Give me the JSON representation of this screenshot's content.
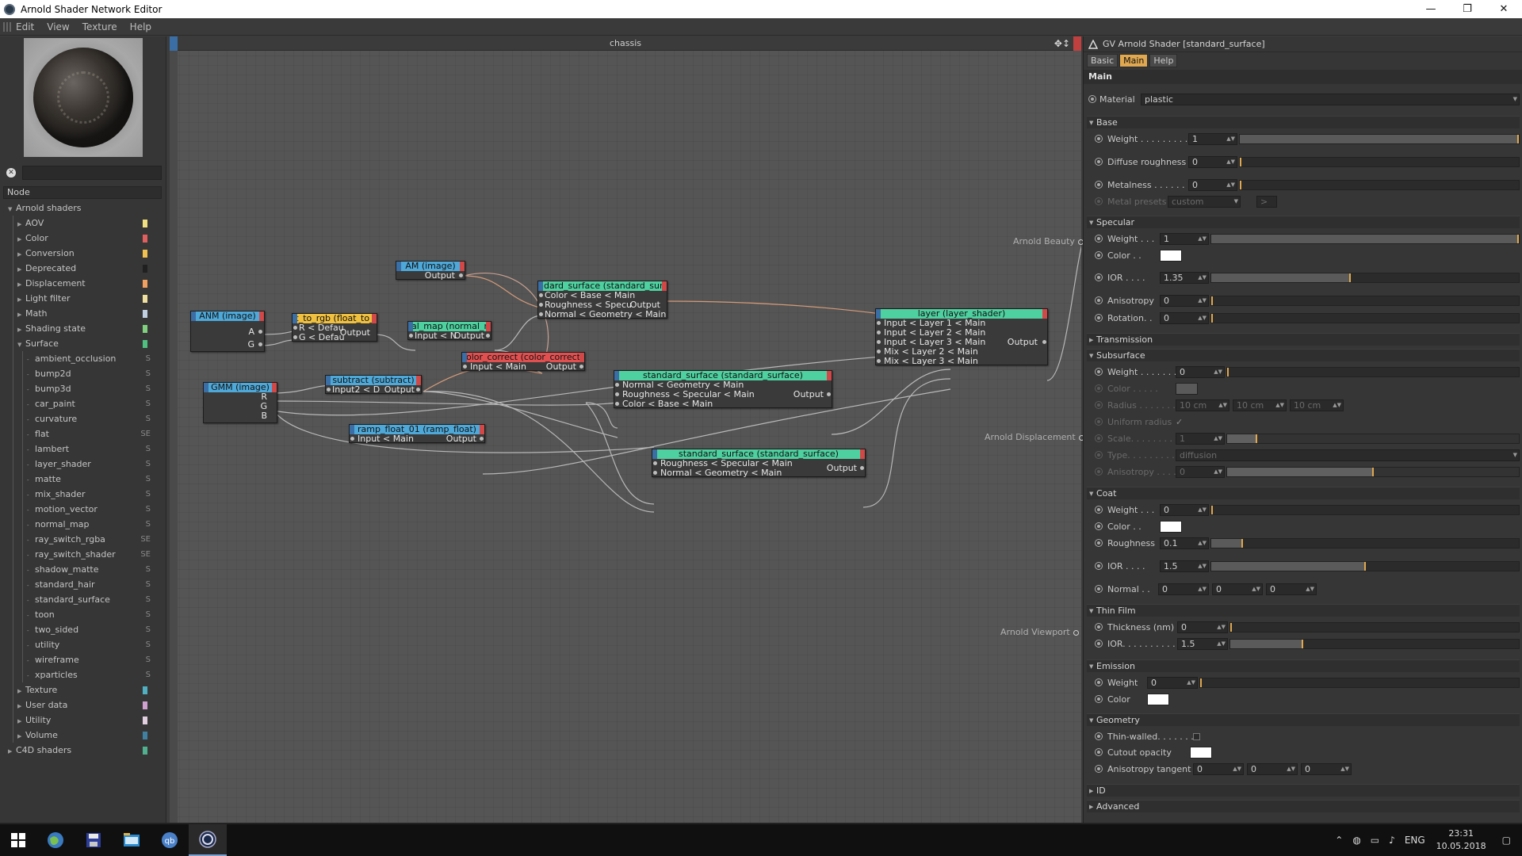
{
  "window": {
    "title": "Arnold Shader Network Editor",
    "buttons": [
      "—",
      "❐",
      "✕"
    ]
  },
  "menu": [
    "Edit",
    "View",
    "Texture",
    "Help"
  ],
  "left": {
    "node_header": "Node",
    "tree": [
      {
        "label": "Arnold shaders",
        "level": 0,
        "arrow": "▼"
      },
      {
        "label": "AOV",
        "level": 1,
        "arrow": "▶",
        "color": "#f0e080"
      },
      {
        "label": "Color",
        "level": 1,
        "arrow": "▶",
        "color": "#e06060"
      },
      {
        "label": "Conversion",
        "level": 1,
        "arrow": "▶",
        "color": "#f0c050"
      },
      {
        "label": "Deprecated",
        "level": 1,
        "arrow": "▶",
        "color": "#202020"
      },
      {
        "label": "Displacement",
        "level": 1,
        "arrow": "▶",
        "color": "#f0a060"
      },
      {
        "label": "Light filter",
        "level": 1,
        "arrow": "▶",
        "color": "#f0e0a0"
      },
      {
        "label": "Math",
        "level": 1,
        "arrow": "▶",
        "color": "#c0d0e0"
      },
      {
        "label": "Shading state",
        "level": 1,
        "arrow": "▶",
        "color": "#80d080"
      },
      {
        "label": "Surface",
        "level": 1,
        "arrow": "▼",
        "color": "#50c080"
      },
      {
        "label": "ambient_occlusion",
        "level": 2,
        "flag": "S"
      },
      {
        "label": "bump2d",
        "level": 2,
        "flag": "S"
      },
      {
        "label": "bump3d",
        "level": 2,
        "flag": "S"
      },
      {
        "label": "car_paint",
        "level": 2,
        "flag": "S"
      },
      {
        "label": "curvature",
        "level": 2,
        "flag": "S"
      },
      {
        "label": "flat",
        "level": 2,
        "flag": "SE"
      },
      {
        "label": "lambert",
        "level": 2,
        "flag": "S"
      },
      {
        "label": "layer_shader",
        "level": 2,
        "flag": "S"
      },
      {
        "label": "matte",
        "level": 2,
        "flag": "S"
      },
      {
        "label": "mix_shader",
        "level": 2,
        "flag": "S"
      },
      {
        "label": "motion_vector",
        "level": 2,
        "flag": "S"
      },
      {
        "label": "normal_map",
        "level": 2,
        "flag": "S"
      },
      {
        "label": "ray_switch_rgba",
        "level": 2,
        "flag": "SE"
      },
      {
        "label": "ray_switch_shader",
        "level": 2,
        "flag": "SE"
      },
      {
        "label": "shadow_matte",
        "level": 2,
        "flag": "S"
      },
      {
        "label": "standard_hair",
        "level": 2,
        "flag": "S"
      },
      {
        "label": "standard_surface",
        "level": 2,
        "flag": "S"
      },
      {
        "label": "toon",
        "level": 2,
        "flag": "S"
      },
      {
        "label": "two_sided",
        "level": 2,
        "flag": "S"
      },
      {
        "label": "utility",
        "level": 2,
        "flag": "S"
      },
      {
        "label": "wireframe",
        "level": 2,
        "flag": "S"
      },
      {
        "label": "xparticles",
        "level": 2,
        "flag": "S"
      },
      {
        "label": "Texture",
        "level": 1,
        "arrow": "▶",
        "color": "#50b0c0"
      },
      {
        "label": "User data",
        "level": 1,
        "arrow": "▶",
        "color": "#d0a0d0"
      },
      {
        "label": "Utility",
        "level": 1,
        "arrow": "▶",
        "color": "#e0d0e0"
      },
      {
        "label": "Volume",
        "level": 1,
        "arrow": "▶",
        "color": "#4080a0"
      },
      {
        "label": "C4D shaders",
        "level": 0,
        "arrow": "▶",
        "color": "#50b090"
      }
    ]
  },
  "canvas": {
    "title": "chassis",
    "nav_icon": "✥↕",
    "outputs": [
      "Arnold Beauty",
      "Arnold Displacement",
      "Arnold Viewport"
    ],
    "nodes": {
      "am": {
        "title": "AM (image)",
        "out": "Output",
        "color": "#4ea8d8"
      },
      "anm": {
        "title": "ANM (image)",
        "a": "A",
        "g": "G",
        "color": "#4ea8d8"
      },
      "ftr": {
        "title": "t_to_rgb (float_to_",
        "r": "R < Defau",
        "g": "G < Defau",
        "out": "Output",
        "color": "#f0c040"
      },
      "nmap": {
        "title": "al_map (normal_r",
        "in": "Input < N",
        "out": "Output",
        "color": "#4ed0a0"
      },
      "ss1": {
        "title": "ndard_surface (standard_surfa",
        "p1": "Color < Base < Main",
        "p2": "Roughness < Specu",
        "p3": "Normal < Geometry < Main",
        "out": "Output",
        "color": "#4ed0a0"
      },
      "cc": {
        "title": "olor_correct (color_correct",
        "in": "Input < Main",
        "out": "Output",
        "color": "#e05050"
      },
      "gmm": {
        "title": "GMM (image)",
        "r": "R",
        "g": "G",
        "b": "B",
        "color": "#4ea8d8"
      },
      "sub": {
        "title": "subtract (subtract)",
        "in": "Input2 < D",
        "out": "Output",
        "color": "#4ea8d8"
      },
      "ss2": {
        "title": "standard_surface (standard_surface)",
        "p1": "Normal < Geometry < Main",
        "p2": "Roughness < Specular < Main",
        "p3": "Color < Base < Main",
        "out": "Output",
        "color": "#4ed0a0"
      },
      "ramp": {
        "title": "ramp_float_01 (ramp_float)",
        "in": "Input < Main",
        "out": "Output",
        "color": "#4ea8d8"
      },
      "ss3": {
        "title": "standard_surface (standard_surface)",
        "p1": "Roughness < Specular < Main",
        "p2": "Normal < Geometry < Main",
        "out": "Output",
        "color": "#4ed0a0"
      },
      "layer": {
        "title": "layer (layer_shader)",
        "p1": "Input < Layer 1 < Main",
        "p2": "Input < Layer 2 < Main",
        "p3": "Input < Layer 3 < Main",
        "p4": "Mix < Layer 2 < Main",
        "p5": "Mix < Layer 3 < Main",
        "out": "Output",
        "color": "#4ed0a0"
      }
    }
  },
  "right": {
    "title": "GV Arnold Shader [standard_surface]",
    "tabs": [
      "Basic",
      "Main",
      "Help"
    ],
    "main_header": "Main",
    "material": {
      "label": "Material",
      "value": "plastic"
    },
    "sections": {
      "base": "Base",
      "specular": "Specular",
      "transmission": "Transmission",
      "subsurface": "Subsurface",
      "coat": "Coat",
      "thin_film": "Thin Film",
      "emission": "Emission",
      "geometry": "Geometry",
      "id": "ID",
      "advanced": "Advanced"
    },
    "base": {
      "weight": {
        "label": "Weight . . . . . . . . .",
        "value": "1",
        "level": 1.0
      },
      "diffuse_roughness": {
        "label": "Diffuse roughness",
        "value": "0",
        "level": 0.0
      },
      "metalness": {
        "label": "Metalness . . . . . .",
        "value": "0",
        "level": 0.0
      },
      "metal_presets": {
        "label": "Metal presets",
        "value": "custom",
        "btn": ">"
      }
    },
    "specular": {
      "weight": {
        "label": "Weight . . .",
        "value": "1",
        "level": 1.0
      },
      "color": {
        "label": "Color . .",
        "value": "#ffffff"
      },
      "ior": {
        "label": "IOR . . . .",
        "value": "1.35",
        "level": 0.45
      },
      "anisotropy": {
        "label": "Anisotropy",
        "value": "0",
        "level": 0.0
      },
      "rotation": {
        "label": "Rotation. .",
        "value": "0",
        "level": 0.0
      }
    },
    "subsurface": {
      "weight": {
        "label": "Weight . . . . . . . .",
        "value": "0",
        "level": 0.0
      },
      "color": {
        "label": "Color . . . . .",
        "value": "#5a5a5a"
      },
      "radius": {
        "label": "Radius . . . . . . . . .",
        "v1": "10 cm",
        "v2": "10 cm",
        "v3": "10 cm"
      },
      "uniform_radius": {
        "label": "Uniform radius",
        "value": "✓"
      },
      "scale": {
        "label": "Scale. . . . . . . . . .",
        "value": "1",
        "level": 0.1
      },
      "type": {
        "label": "Type. . . . . . . . . . .",
        "value": "diffusion"
      },
      "anisotropy": {
        "label": "Anisotropy . . . . .",
        "value": "0",
        "level": 0.5
      }
    },
    "coat": {
      "weight": {
        "label": "Weight . . .",
        "value": "0",
        "level": 0.0
      },
      "color": {
        "label": "Color . .",
        "value": "#ffffff"
      },
      "roughness": {
        "label": "Roughness",
        "value": "0.1",
        "level": 0.1
      },
      "ior": {
        "label": "IOR . . . .",
        "value": "1.5",
        "level": 0.5
      },
      "normal": {
        "label": "Normal . .",
        "v1": "0",
        "v2": "0",
        "v3": "0"
      }
    },
    "thin_film": {
      "thickness": {
        "label": "Thickness (nm)",
        "value": "0",
        "level": 0.0
      },
      "ior": {
        "label": "IOR. . . . . . . . . .",
        "value": "1.5",
        "level": 0.25
      }
    },
    "emission": {
      "weight": {
        "label": "Weight",
        "value": "0",
        "level": 0.0
      },
      "color": {
        "label": "Color",
        "value": "#ffffff"
      }
    },
    "geometry": {
      "thin_walled": {
        "label": "Thin-walled. . . . . . ."
      },
      "cutout_opacity": {
        "label": "Cutout opacity",
        "value": "#ffffff"
      },
      "anisotropy_tangent": {
        "label": "Anisotropy tangent",
        "v1": "0",
        "v2": "0",
        "v3": "0"
      }
    }
  },
  "taskbar": {
    "lang": "ENG",
    "time": "23:31",
    "date": "10.05.2018",
    "icons": [
      "windows-icon",
      "globe-icon",
      "save-icon",
      "explorer-icon",
      "qbittorrent-icon",
      "cinema4d-icon"
    ]
  }
}
